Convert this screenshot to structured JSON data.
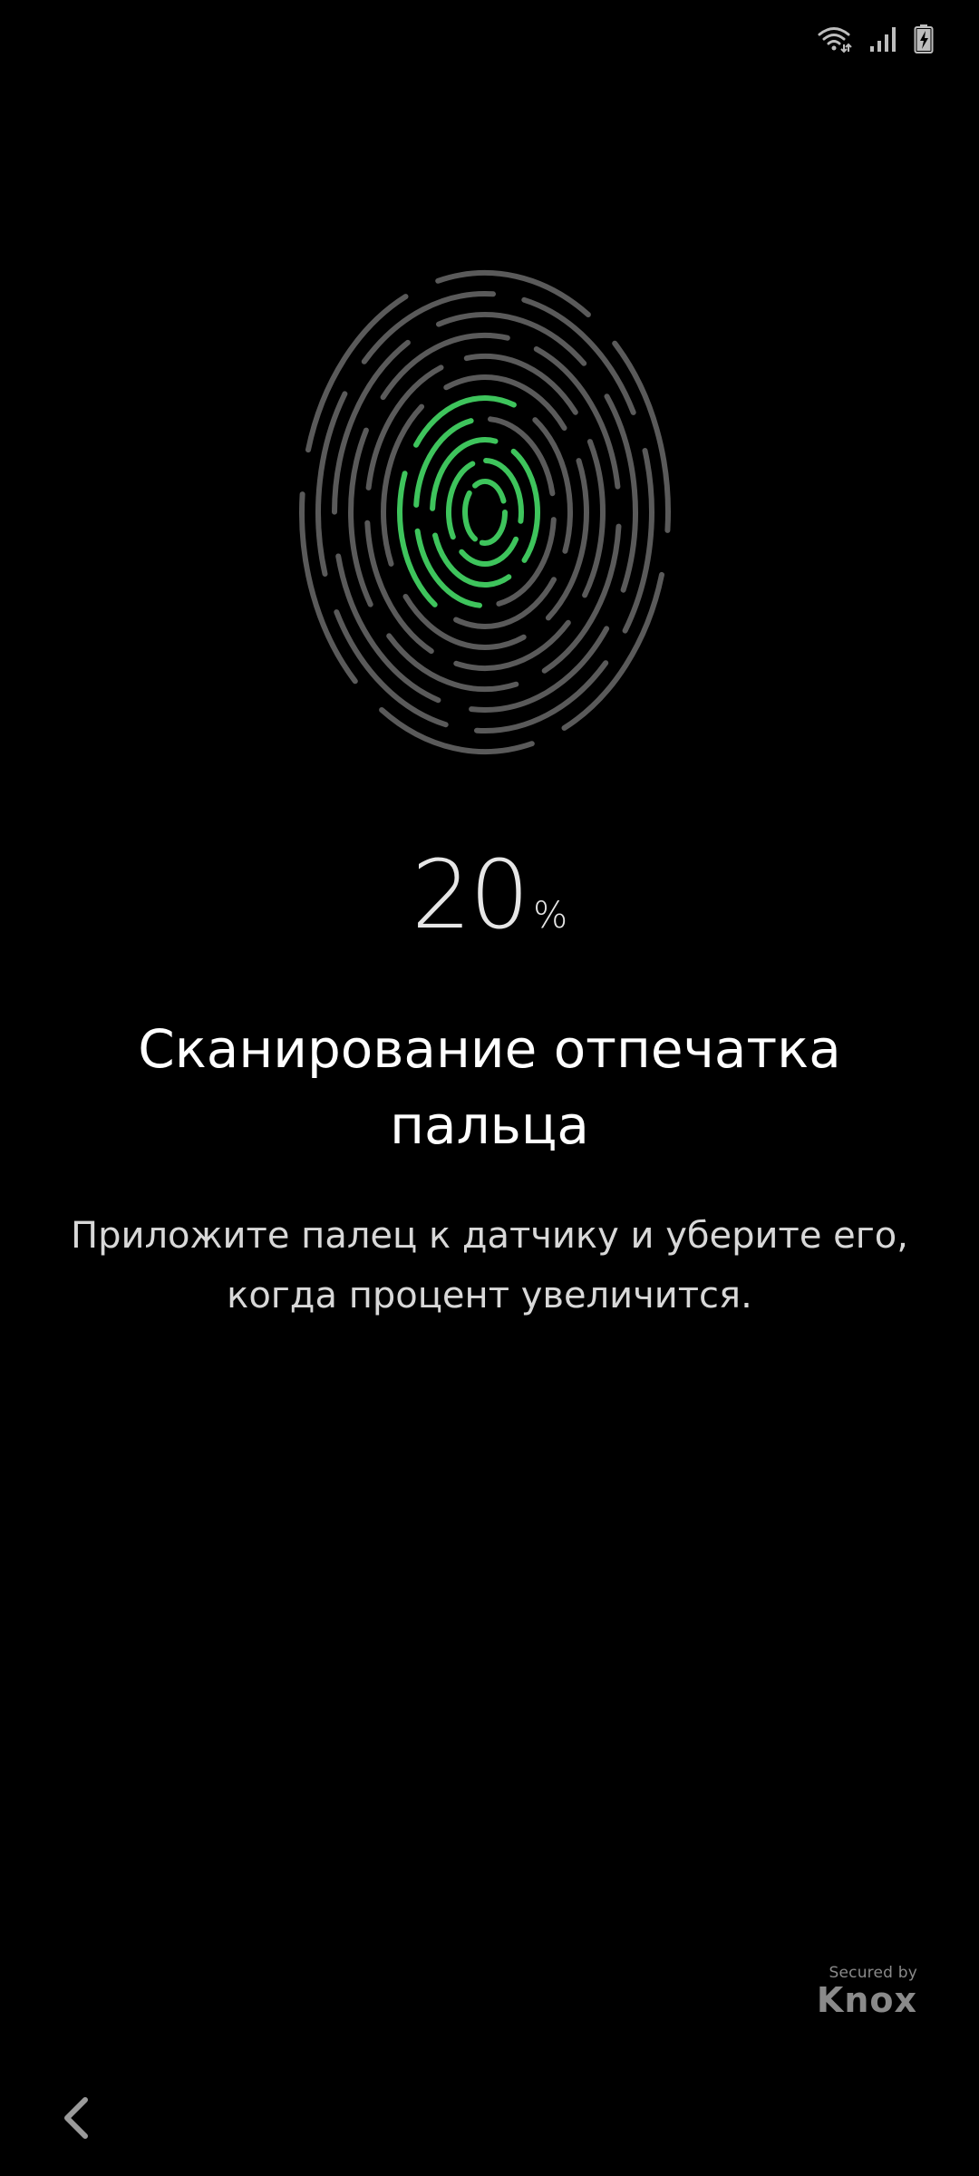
{
  "status_bar": {
    "icons": [
      "wifi-icon",
      "signal-icon",
      "battery-charging-icon"
    ]
  },
  "fingerprint": {
    "icon": "fingerprint-icon",
    "progress_fraction": 0.2,
    "accent_color": "#3ec45c",
    "base_color": "#5a5a5a"
  },
  "progress": {
    "value": "20",
    "unit": "%"
  },
  "title": "Сканирование отпечатка пальца",
  "description": "Приложите палец к датчику и уберите его, когда процент увеличится.",
  "badge": {
    "secured_label": "Secured by",
    "brand": "Knox"
  },
  "navigation": {
    "back_icon": "chevron-left-icon"
  }
}
